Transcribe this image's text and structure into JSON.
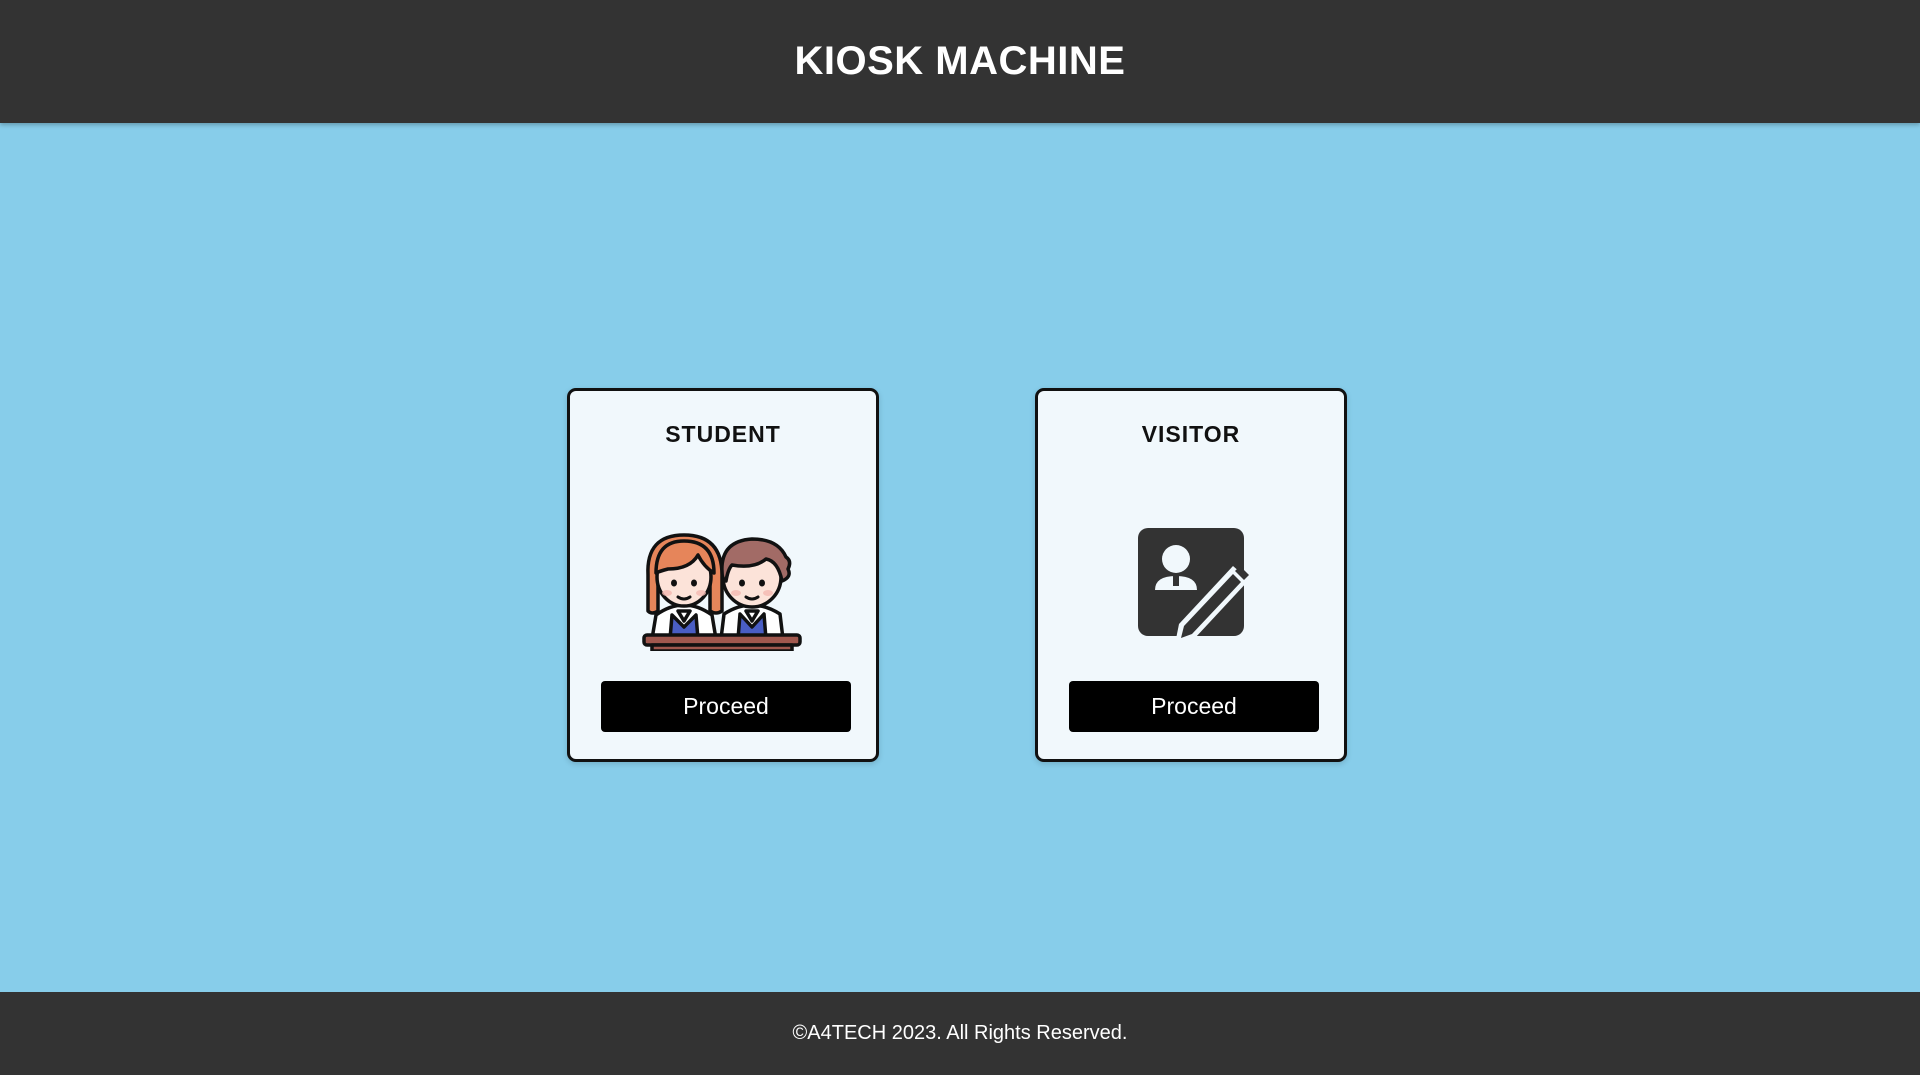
{
  "header": {
    "title": "KIOSK MACHINE"
  },
  "cards": [
    {
      "title": "STUDENT",
      "icon": "students-icon",
      "button_label": "Proceed"
    },
    {
      "title": "VISITOR",
      "icon": "visitor-register-icon",
      "button_label": "Proceed"
    }
  ],
  "footer": {
    "copyright": "©A4TECH 2023. All Rights Reserved."
  },
  "colors": {
    "header_bg": "#333333",
    "page_bg": "#87CDEA",
    "card_bg": "#F1F8FC",
    "button_bg": "#000000",
    "button_text": "#FFFFFF"
  }
}
